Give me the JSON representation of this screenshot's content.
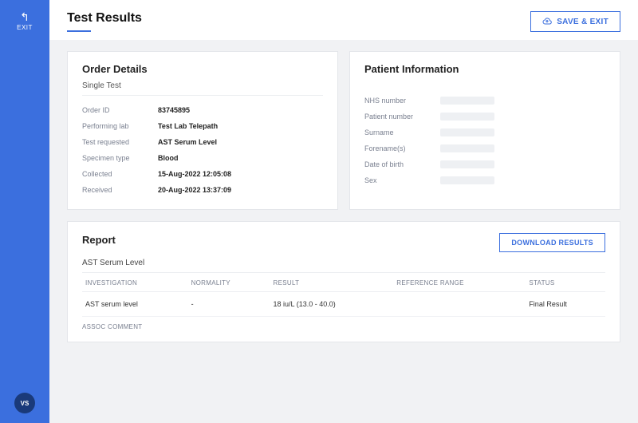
{
  "sidebar": {
    "exit_label": "EXIT",
    "badge": "VS"
  },
  "header": {
    "title": "Test Results",
    "save_exit_label": "SAVE & EXIT"
  },
  "order_details": {
    "heading": "Order Details",
    "subheading": "Single Test",
    "rows": [
      {
        "label": "Order ID",
        "value": "83745895"
      },
      {
        "label": "Performing lab",
        "value": "Test Lab Telepath"
      },
      {
        "label": "Test requested",
        "value": "AST Serum Level"
      },
      {
        "label": "Specimen type",
        "value": "Blood"
      },
      {
        "label": "Collected",
        "value": "15-Aug-2022 12:05:08"
      },
      {
        "label": "Received",
        "value": "20-Aug-2022 13:37:09"
      }
    ]
  },
  "patient_info": {
    "heading": "Patient Information",
    "rows": [
      {
        "label": "NHS number"
      },
      {
        "label": "Patient number"
      },
      {
        "label": "Surname"
      },
      {
        "label": "Forename(s)"
      },
      {
        "label": "Date of birth"
      },
      {
        "label": "Sex"
      }
    ]
  },
  "report": {
    "heading": "Report",
    "download_label": "DOWNLOAD RESULTS",
    "subheading": "AST Serum Level",
    "columns": {
      "investigation": "INVESTIGATION",
      "normality": "NORMALITY",
      "result": "RESULT",
      "reference_range": "REFERENCE RANGE",
      "status": "STATUS"
    },
    "rows": [
      {
        "investigation": "AST serum level",
        "normality": "-",
        "result": "18 iu/L (13.0 - 40.0)",
        "reference_range": "",
        "status": "Final Result"
      }
    ],
    "assoc_label": "ASSOC COMMENT"
  },
  "colors": {
    "accent": "#3b6fde",
    "badge_bg": "#1a3a7a"
  }
}
